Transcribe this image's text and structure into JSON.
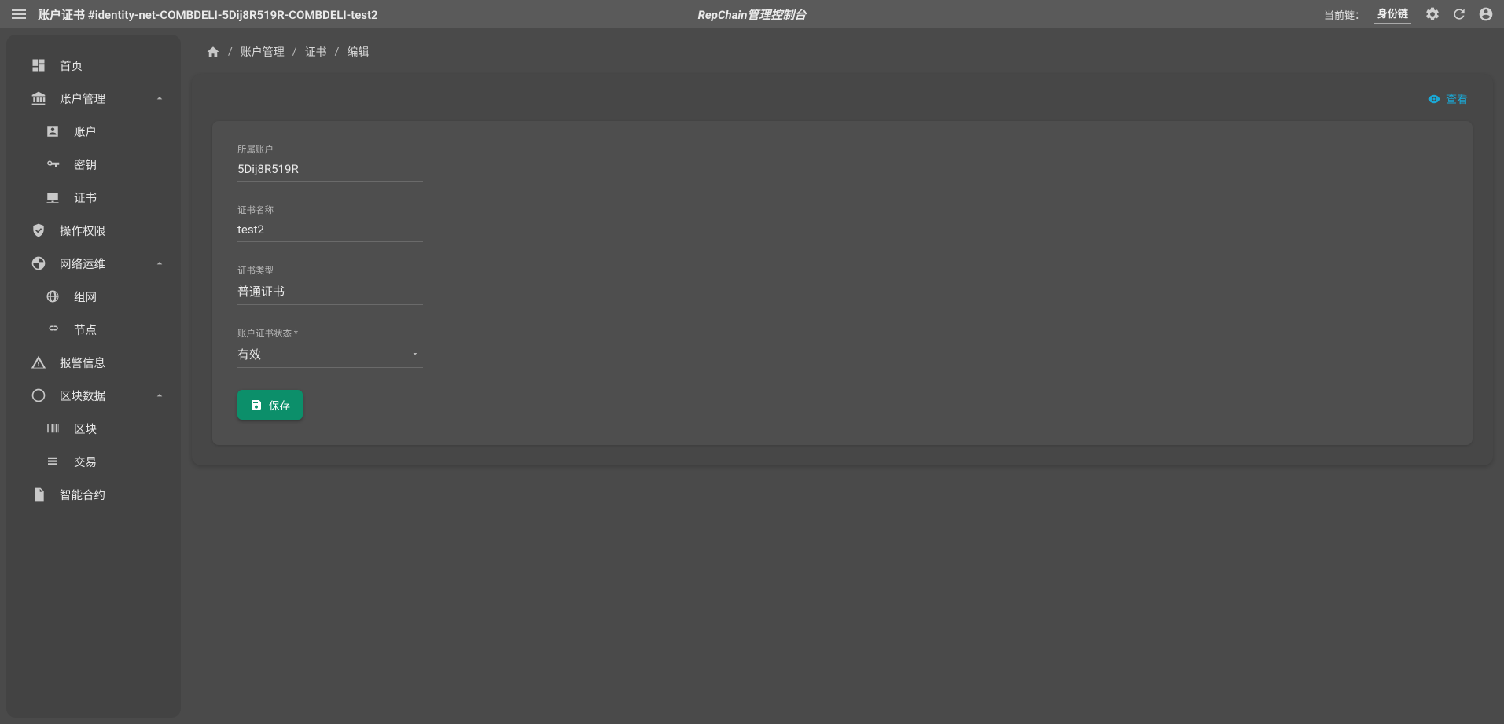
{
  "appbar": {
    "title": "账户证书 #identity-net-COMBDELI-5Dij8R519R-COMBDELI-test2",
    "center": "RepChain管理控制台",
    "chain_label": "当前链：",
    "chain_value": "身份链"
  },
  "sidebar": {
    "home": "首页",
    "account_mgmt": "账户管理",
    "account": "账户",
    "key": "密钥",
    "cert": "证书",
    "op_perm": "操作权限",
    "net_ops": "网络运维",
    "networking": "组网",
    "node": "节点",
    "alarm": "报警信息",
    "block_data": "区块数据",
    "block": "区块",
    "tx": "交易",
    "contract": "智能合约"
  },
  "breadcrumb": {
    "account_mgmt": "账户管理",
    "cert": "证书",
    "edit": "编辑"
  },
  "actions": {
    "view": "查看",
    "save": "保存"
  },
  "form": {
    "owner_label": "所属账户",
    "owner_value": "5Dij8R519R",
    "name_label": "证书名称",
    "name_value": "test2",
    "type_label": "证书类型",
    "type_value": "普通证书",
    "status_label": "账户证书状态 *",
    "status_value": "有效"
  }
}
